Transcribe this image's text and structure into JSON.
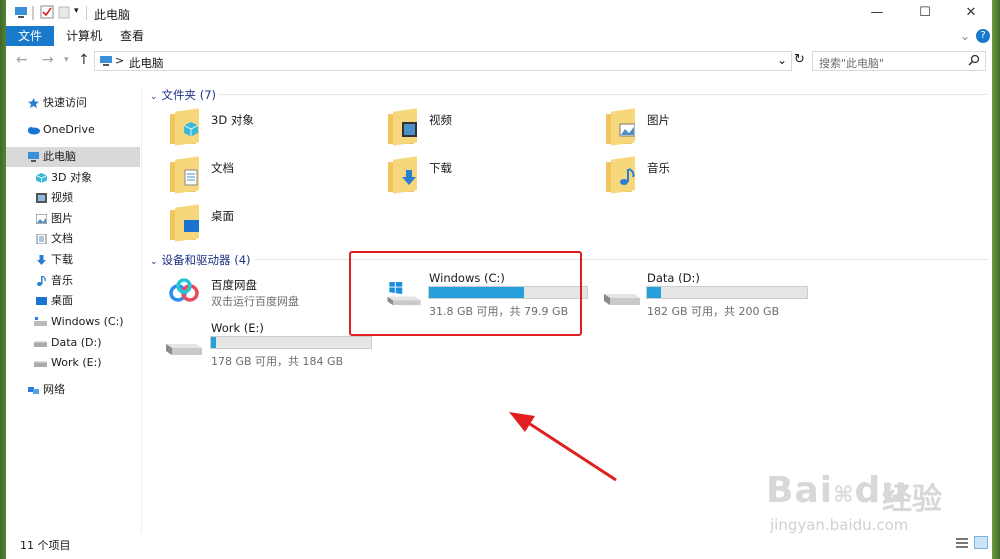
{
  "titlebar": {
    "title": "此电脑",
    "minimize": "—",
    "maximize": "☐",
    "close": "✕"
  },
  "ribbon": {
    "tabs": [
      "文件",
      "计算机",
      "查看"
    ],
    "help": "?"
  },
  "address": {
    "breadcrumb_sep": ">",
    "path": "此电脑",
    "search_placeholder": "搜索\"此电脑\""
  },
  "sidebar": {
    "items": [
      {
        "label": "快速访问",
        "icon": "star-icon"
      },
      {
        "label": "OneDrive",
        "icon": "cloud-icon"
      },
      {
        "label": "此电脑",
        "icon": "computer-icon",
        "selected": true
      },
      {
        "label": "3D 对象",
        "icon": "cube-icon"
      },
      {
        "label": "视频",
        "icon": "video-icon"
      },
      {
        "label": "图片",
        "icon": "picture-icon"
      },
      {
        "label": "文档",
        "icon": "document-icon"
      },
      {
        "label": "下载",
        "icon": "download-icon"
      },
      {
        "label": "音乐",
        "icon": "music-icon"
      },
      {
        "label": "桌面",
        "icon": "desktop-icon"
      },
      {
        "label": "Windows (C:)",
        "icon": "drive-icon"
      },
      {
        "label": "Data (D:)",
        "icon": "drive-icon"
      },
      {
        "label": "Work (E:)",
        "icon": "drive-icon"
      },
      {
        "label": "网络",
        "icon": "network-icon"
      }
    ]
  },
  "folders_group": {
    "title": "文件夹 (7)",
    "items": [
      {
        "label": "3D 对象"
      },
      {
        "label": "视频"
      },
      {
        "label": "图片"
      },
      {
        "label": "文档"
      },
      {
        "label": "下载"
      },
      {
        "label": "音乐"
      },
      {
        "label": "桌面"
      }
    ]
  },
  "devices_group": {
    "title": "设备和驱动器 (4)",
    "baidu": {
      "label": "百度网盘",
      "sub": "双击运行百度网盘"
    },
    "drives": [
      {
        "label": "Windows (C:)",
        "sub": "31.8 GB 可用，共 79.9 GB",
        "used_fraction": 0.6
      },
      {
        "label": "Data (D:)",
        "sub": "182 GB 可用，共 200 GB",
        "used_fraction": 0.09
      },
      {
        "label": "Work (E:)",
        "sub": "178 GB 可用，共 184 GB",
        "used_fraction": 0.03
      }
    ]
  },
  "status": {
    "count": "11 个项目"
  },
  "watermark": {
    "line1": "Bai",
    "line2": "du",
    "cn": "经验",
    "url": "jingyan.baidu.com"
  },
  "colors": {
    "accent": "#1979ca",
    "bar_fill": "#26a0da",
    "annotation": "#e02020"
  }
}
